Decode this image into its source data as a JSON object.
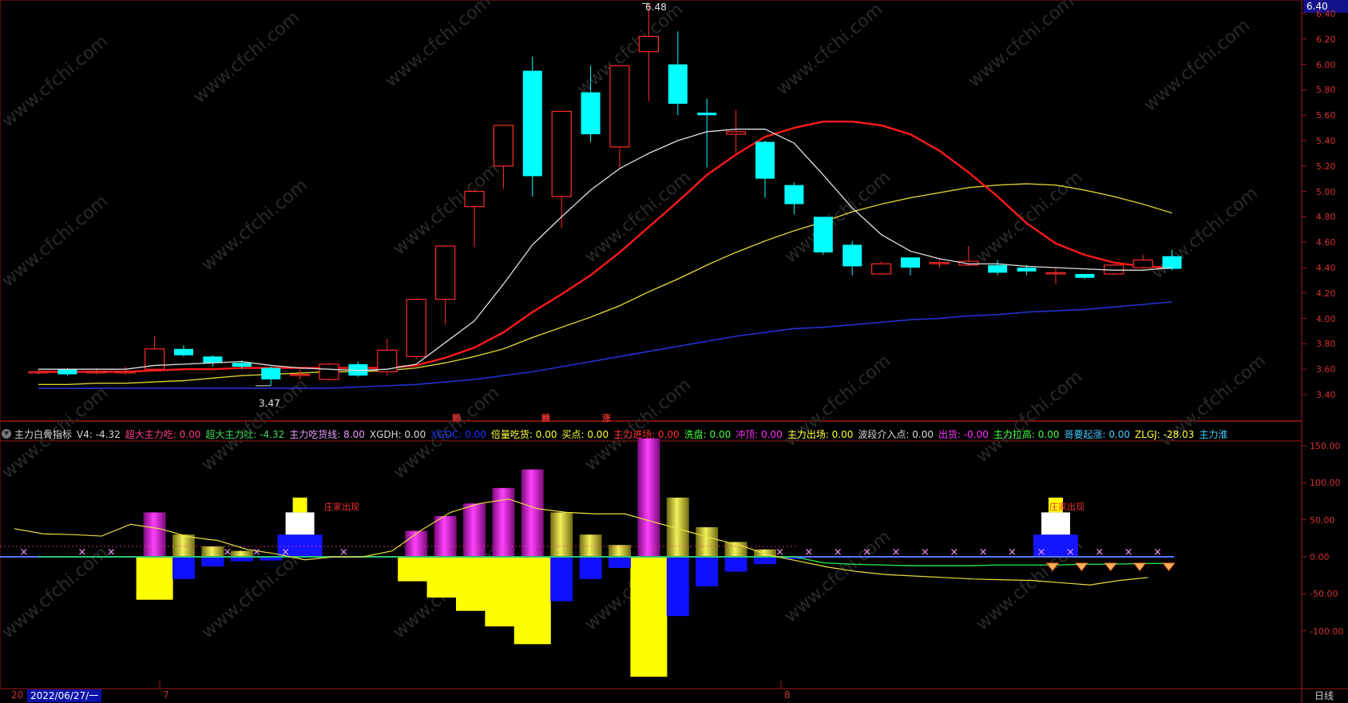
{
  "price_panel": {
    "axis_ticks": [
      "6.40",
      "6.20",
      "6.00",
      "5.80",
      "5.60",
      "5.40",
      "5.20",
      "5.00",
      "4.80",
      "4.60",
      "4.40",
      "4.20",
      "4.00",
      "3.80",
      "3.60",
      "3.40"
    ],
    "current_price_tag": "6.40",
    "high_label": "6.48",
    "low_label": "3.47",
    "signal_labels": [
      "赖",
      "赣",
      "涨"
    ]
  },
  "indicator_bar": {
    "items": [
      {
        "text": "主力白骨指标",
        "color": "#d8d8d8"
      },
      {
        "text": "V4: -4.32",
        "color": "#d8d8d8"
      },
      {
        "text": "超大主力吃: 0.00",
        "color": "#ff3d8a"
      },
      {
        "text": "超大主力吐: -4.32",
        "color": "#3ddc5a"
      },
      {
        "text": "主力吃货线: 8.00",
        "color": "#e59aff"
      },
      {
        "text": "XGDH: 0.00",
        "color": "#d8d8d8"
      },
      {
        "text": "XGDC: 0.00",
        "color": "#2233ff"
      },
      {
        "text": "倍量吃货: 0.00",
        "color": "#ffff3a"
      },
      {
        "text": "买点: 0.00",
        "color": "#ffff3a"
      },
      {
        "text": "主力进场: 0.00",
        "color": "#ff3030"
      },
      {
        "text": "洗盘: 0.00",
        "color": "#44ff44"
      },
      {
        "text": "冲顶: 0.00",
        "color": "#ff30ff"
      },
      {
        "text": "主力出场: 0.00",
        "color": "#ffff3a"
      },
      {
        "text": "波段介入点: 0.00",
        "color": "#d8d8d8"
      },
      {
        "text": "出货: -0.00",
        "color": "#ff30ff"
      },
      {
        "text": "主力拉高: 0.00",
        "color": "#44ff44"
      },
      {
        "text": "哥要起涨: 0.00",
        "color": "#44ccff"
      },
      {
        "text": "ZLGJ: -28.03",
        "color": "#ffff3a"
      },
      {
        "text": "主力淮",
        "color": "#44ccff"
      }
    ]
  },
  "indicator_panel": {
    "axis_ticks": [
      "150.00",
      "100.00",
      "50.00",
      "0.00",
      "-50.00",
      "-100.00"
    ],
    "dealer_label": "庄家出现"
  },
  "bottom_bar": {
    "cursor_date": "2022/06/27/一",
    "left_fragment": "20",
    "month_ticks": [
      "7",
      "8"
    ],
    "period": "日线"
  },
  "colors": {
    "up": "#ff2a2a",
    "down": "#00ffff",
    "ma5": "#e0e0e0",
    "ma10": "#ff1a1a",
    "ma20": "#d8d030",
    "ma60": "#2430d0",
    "axis": "#a01818"
  },
  "chart_data": [
    {
      "type": "candlestick",
      "title": "",
      "ylim": [
        3.34,
        6.48
      ],
      "candles": [
        {
          "o": 3.58,
          "c": 3.58,
          "h": 3.6,
          "l": 3.56
        },
        {
          "o": 3.6,
          "c": 3.56,
          "h": 3.61,
          "l": 3.55
        },
        {
          "o": 3.58,
          "c": 3.58,
          "h": 3.61,
          "l": 3.56
        },
        {
          "o": 3.58,
          "c": 3.58,
          "h": 3.62,
          "l": 3.56
        },
        {
          "o": 3.6,
          "c": 3.76,
          "h": 3.86,
          "l": 3.59
        },
        {
          "o": 3.76,
          "c": 3.71,
          "h": 3.79,
          "l": 3.7
        },
        {
          "o": 3.7,
          "c": 3.65,
          "h": 3.71,
          "l": 3.62
        },
        {
          "o": 3.65,
          "c": 3.62,
          "h": 3.67,
          "l": 3.6
        },
        {
          "o": 3.61,
          "c": 3.52,
          "h": 3.62,
          "l": 3.47
        },
        {
          "o": 3.56,
          "c": 3.56,
          "h": 3.6,
          "l": 3.52
        },
        {
          "o": 3.52,
          "c": 3.64,
          "h": 3.65,
          "l": 3.51
        },
        {
          "o": 3.64,
          "c": 3.55,
          "h": 3.66,
          "l": 3.54
        },
        {
          "o": 3.58,
          "c": 3.75,
          "h": 3.84,
          "l": 3.55
        },
        {
          "o": 3.7,
          "c": 4.15,
          "h": 4.16,
          "l": 3.68
        },
        {
          "o": 4.15,
          "c": 4.57,
          "h": 4.57,
          "l": 3.95
        },
        {
          "o": 4.88,
          "c": 5.0,
          "h": 5.02,
          "l": 4.56
        },
        {
          "o": 5.2,
          "c": 5.52,
          "h": 5.52,
          "l": 5.02
        },
        {
          "o": 5.95,
          "c": 5.12,
          "h": 6.06,
          "l": 4.96
        },
        {
          "o": 4.96,
          "c": 5.63,
          "h": 5.63,
          "l": 4.71
        },
        {
          "o": 5.78,
          "c": 5.45,
          "h": 5.99,
          "l": 5.39
        },
        {
          "o": 5.35,
          "c": 5.99,
          "h": 5.99,
          "l": 5.17
        },
        {
          "o": 6.1,
          "c": 6.22,
          "h": 6.48,
          "l": 5.71
        },
        {
          "o": 6.0,
          "c": 5.69,
          "h": 6.26,
          "l": 5.6
        },
        {
          "o": 5.62,
          "c": 5.6,
          "h": 5.73,
          "l": 5.19
        },
        {
          "o": 5.45,
          "c": 5.47,
          "h": 5.64,
          "l": 5.3
        },
        {
          "o": 5.39,
          "c": 5.1,
          "h": 5.4,
          "l": 4.95
        },
        {
          "o": 5.05,
          "c": 4.9,
          "h": 5.07,
          "l": 4.82
        },
        {
          "o": 4.8,
          "c": 4.52,
          "h": 4.8,
          "l": 4.5
        },
        {
          "o": 4.58,
          "c": 4.41,
          "h": 4.61,
          "l": 4.34
        },
        {
          "o": 4.35,
          "c": 4.43,
          "h": 4.45,
          "l": 4.35
        },
        {
          "o": 4.48,
          "c": 4.4,
          "h": 4.48,
          "l": 4.34
        },
        {
          "o": 4.44,
          "c": 4.44,
          "h": 4.47,
          "l": 4.4
        },
        {
          "o": 4.42,
          "c": 4.45,
          "h": 4.57,
          "l": 4.41
        },
        {
          "o": 4.42,
          "c": 4.36,
          "h": 4.46,
          "l": 4.34
        },
        {
          "o": 4.4,
          "c": 4.37,
          "h": 4.42,
          "l": 4.34
        },
        {
          "o": 4.36,
          "c": 4.36,
          "h": 4.4,
          "l": 4.27
        },
        {
          "o": 4.35,
          "c": 4.32,
          "h": 4.35,
          "l": 4.31
        },
        {
          "o": 4.35,
          "c": 4.42,
          "h": 4.43,
          "l": 4.34
        },
        {
          "o": 4.4,
          "c": 4.46,
          "h": 4.5,
          "l": 4.39
        },
        {
          "o": 4.49,
          "c": 4.39,
          "h": 4.54,
          "l": 4.38
        }
      ],
      "ma5": [
        3.6,
        3.6,
        3.6,
        3.6,
        3.63,
        3.64,
        3.65,
        3.66,
        3.63,
        3.61,
        3.6,
        3.59,
        3.6,
        3.64,
        3.81,
        3.98,
        4.27,
        4.58,
        4.8,
        5.01,
        5.18,
        5.3,
        5.4,
        5.47,
        5.49,
        5.49,
        5.38,
        5.13,
        4.87,
        4.66,
        4.53,
        4.47,
        4.43,
        4.43,
        4.41,
        4.4,
        4.39,
        4.38,
        4.38,
        4.4
      ],
      "ma10": [
        3.58,
        3.58,
        3.58,
        3.58,
        3.59,
        3.6,
        3.6,
        3.61,
        3.61,
        3.61,
        3.61,
        3.61,
        3.61,
        3.63,
        3.69,
        3.77,
        3.89,
        4.05,
        4.19,
        4.34,
        4.52,
        4.72,
        4.92,
        5.13,
        5.29,
        5.43,
        5.5,
        5.55,
        5.55,
        5.52,
        5.45,
        5.32,
        5.15,
        4.96,
        4.75,
        4.59,
        4.5,
        4.44,
        4.41,
        4.4
      ],
      "ma20": [
        3.48,
        3.48,
        3.49,
        3.49,
        3.5,
        3.51,
        3.53,
        3.55,
        3.56,
        3.57,
        3.58,
        3.58,
        3.59,
        3.61,
        3.65,
        3.7,
        3.76,
        3.85,
        3.93,
        4.01,
        4.1,
        4.21,
        4.31,
        4.42,
        4.52,
        4.61,
        4.69,
        4.76,
        4.84,
        4.9,
        4.95,
        4.99,
        5.03,
        5.05,
        5.06,
        5.05,
        5.01,
        4.96,
        4.9,
        4.83
      ],
      "ma60": [
        3.45,
        3.45,
        3.45,
        3.45,
        3.45,
        3.45,
        3.45,
        3.45,
        3.45,
        3.45,
        3.45,
        3.46,
        3.47,
        3.48,
        3.5,
        3.52,
        3.55,
        3.58,
        3.62,
        3.66,
        3.7,
        3.74,
        3.78,
        3.82,
        3.86,
        3.89,
        3.92,
        3.93,
        3.95,
        3.97,
        3.99,
        4.0,
        4.02,
        4.03,
        4.05,
        4.06,
        4.07,
        4.09,
        4.11,
        4.13
      ]
    },
    {
      "type": "bar",
      "title": "主力白骨指标",
      "ylim": [
        -160,
        160
      ],
      "pos_bars": [
        {
          "i": 4,
          "v": 60,
          "c": "magenta"
        },
        {
          "i": 5,
          "v": 30,
          "c": "yellow"
        },
        {
          "i": 6,
          "v": 14,
          "c": "yellow"
        },
        {
          "i": 7,
          "v": 8,
          "c": "yellow"
        },
        {
          "i": 13,
          "v": 35,
          "c": "magenta"
        },
        {
          "i": 14,
          "v": 55,
          "c": "magenta"
        },
        {
          "i": 15,
          "v": 72,
          "c": "magenta"
        },
        {
          "i": 16,
          "v": 93,
          "c": "magenta"
        },
        {
          "i": 17,
          "v": 118,
          "c": "magenta"
        },
        {
          "i": 18,
          "v": 60,
          "c": "yellow"
        },
        {
          "i": 19,
          "v": 30,
          "c": "yellow"
        },
        {
          "i": 20,
          "v": 16,
          "c": "yellow"
        },
        {
          "i": 21,
          "v": 160,
          "c": "magenta"
        },
        {
          "i": 22,
          "v": 80,
          "c": "yellow"
        },
        {
          "i": 23,
          "v": 40,
          "c": "yellow"
        },
        {
          "i": 24,
          "v": 20,
          "c": "yellow"
        },
        {
          "i": 25,
          "v": 10,
          "c": "yellow"
        }
      ],
      "neg_yellow": [
        {
          "i": 4,
          "v": -58
        },
        {
          "i": 13,
          "v": -33
        },
        {
          "i": 14,
          "v": -55
        },
        {
          "i": 15,
          "v": -73
        },
        {
          "i": 16,
          "v": -94
        },
        {
          "i": 17,
          "v": -118
        },
        {
          "i": 21,
          "v": -162
        }
      ],
      "neg_blue": [
        {
          "i": 5,
          "v": -30
        },
        {
          "i": 6,
          "v": -13
        },
        {
          "i": 7,
          "v": -6
        },
        {
          "i": 8,
          "v": -5
        },
        {
          "i": 18,
          "v": -60
        },
        {
          "i": 19,
          "v": -30
        },
        {
          "i": 20,
          "v": -15
        },
        {
          "i": 22,
          "v": -80
        },
        {
          "i": 23,
          "v": -40
        },
        {
          "i": 24,
          "v": -20
        },
        {
          "i": 25,
          "v": -10
        },
        {
          "i": 26,
          "v": -3
        }
      ],
      "zlgj": [
        38,
        31,
        30,
        28,
        44,
        38,
        27,
        22,
        10,
        4,
        -4,
        0,
        0,
        8,
        36,
        60,
        72,
        78,
        65,
        60,
        58,
        58,
        47,
        36,
        25,
        15,
        2,
        -6,
        -14,
        -20,
        -24,
        -26,
        -28,
        -30,
        -31,
        -32,
        -35,
        -38,
        -32,
        -28
      ],
      "green": [
        0,
        0,
        0,
        0,
        0,
        0,
        0,
        0,
        0,
        0,
        0,
        0,
        0,
        0,
        0,
        0,
        0,
        0,
        0,
        0,
        0,
        0,
        0,
        0,
        0,
        0,
        0,
        -8,
        -10,
        -11,
        -12,
        -12,
        -12,
        -11,
        -11,
        -11,
        -10,
        -10,
        -9,
        -9
      ],
      "x_marks": [
        0,
        2,
        3,
        7,
        8,
        9,
        11,
        26,
        27,
        28,
        29,
        30,
        31,
        32,
        33,
        34,
        35,
        36,
        37,
        38,
        39
      ],
      "diamonds": [
        35,
        36,
        37,
        38,
        39
      ],
      "dealer": [
        {
          "i": 9
        },
        {
          "i": 35
        }
      ]
    }
  ]
}
